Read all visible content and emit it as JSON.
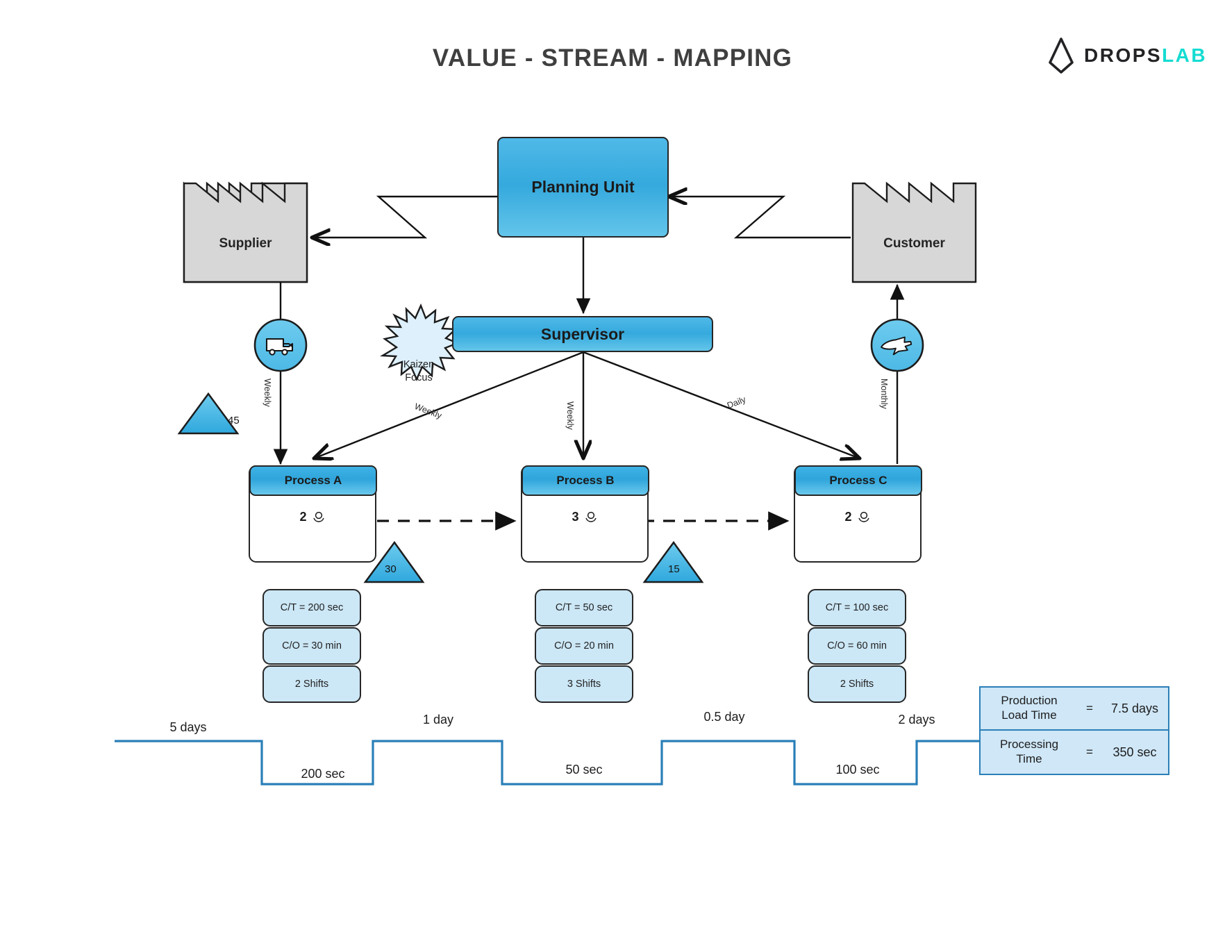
{
  "header": {
    "title": "VALUE - STREAM - MAPPING",
    "logo_primary": "DROPS",
    "logo_accent": "LAB",
    "logo_icon": "droplet-icon"
  },
  "colors": {
    "accent_blue": "#35a9dd",
    "light_blue_fill": "#cce7f6",
    "external_gray": "#d7d7d7",
    "timeline_blue": "#2a7fb8",
    "logo_accent": "#14dcd2",
    "text_dark": "#1f1f1f"
  },
  "external_entities": [
    {
      "name": "Supplier",
      "label": "Supplier"
    },
    {
      "name": "Customer",
      "label": "Customer"
    }
  ],
  "control": {
    "planning_unit": "Planning Unit",
    "supervisor": "Supervisor"
  },
  "kaizen": {
    "line1": "Kaizen",
    "line2": "Focus"
  },
  "transport": [
    {
      "icon": "truck-icon",
      "frequency": "Weekly"
    },
    {
      "icon": "airplane-icon",
      "frequency": "Monthly"
    }
  ],
  "schedule_labels": {
    "to_a": "Weekly",
    "to_b": "Weekly",
    "to_c": "Daily"
  },
  "processes": [
    {
      "title": "Process A",
      "operators": "2",
      "operator_icon": "operator-icon",
      "data": [
        "C/T = 200 sec",
        "C/O = 30 min",
        "2 Shifts"
      ]
    },
    {
      "title": "Process B",
      "operators": "3",
      "operator_icon": "operator-icon",
      "data": [
        "C/T = 50 sec",
        "C/O = 20 min",
        "3 Shifts"
      ]
    },
    {
      "title": "Process C",
      "operators": "2",
      "operator_icon": "operator-icon",
      "data": [
        "C/T = 100 sec",
        "C/O = 60 min",
        "2 Shifts"
      ]
    }
  ],
  "inventory": [
    {
      "value": "45"
    },
    {
      "value": "30"
    },
    {
      "value": "15"
    }
  ],
  "timeline": {
    "lead_times": [
      "5 days",
      "1 day",
      "0.5 day",
      "2 days"
    ],
    "process_times": [
      "200 sec",
      "50 sec",
      "100 sec"
    ]
  },
  "summary": {
    "rows": [
      {
        "name_line1": "Production",
        "name_line2": "Load Time",
        "eq": "=",
        "value": "7.5 days"
      },
      {
        "name_line1": "Processing",
        "name_line2": "Time",
        "eq": "=",
        "value": "350 sec"
      }
    ]
  },
  "chart_data": {
    "type": "diagram",
    "title": "VALUE - STREAM - MAPPING",
    "nodes": [
      {
        "id": "supplier",
        "label": "Supplier",
        "type": "external-entity"
      },
      {
        "id": "customer",
        "label": "Customer",
        "type": "external-entity"
      },
      {
        "id": "planning",
        "label": "Planning Unit",
        "type": "control"
      },
      {
        "id": "supervisor",
        "label": "Supervisor",
        "type": "control"
      },
      {
        "id": "procA",
        "label": "Process A",
        "type": "process",
        "operators": 2,
        "ct": "200 sec",
        "co": "30 min",
        "shifts": 2
      },
      {
        "id": "procB",
        "label": "Process B",
        "type": "process",
        "operators": 3,
        "ct": "50 sec",
        "co": "20 min",
        "shifts": 3
      },
      {
        "id": "procC",
        "label": "Process C",
        "type": "process",
        "operators": 2,
        "ct": "100 sec",
        "co": "60 min",
        "shifts": 2
      }
    ],
    "inventory_points": [
      45,
      30,
      15
    ],
    "lead_time_days": [
      5,
      1,
      0.5,
      2
    ],
    "process_time_sec": [
      200,
      50,
      100
    ],
    "totals": {
      "production_load_time": "7.5 days",
      "processing_time": "350 sec"
    }
  }
}
